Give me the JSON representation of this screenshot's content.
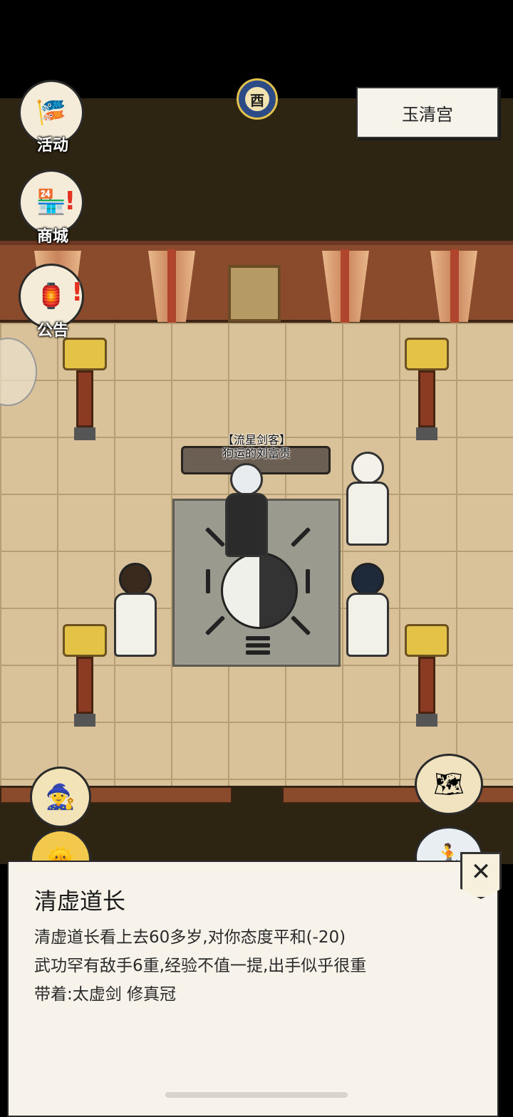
{
  "location": {
    "name": "玉清宫"
  },
  "clock": {
    "hour_glyph": "酉"
  },
  "side_menu": [
    {
      "key": "activity",
      "label": "活动",
      "icon": "banner-scroll-icon",
      "alert": ""
    },
    {
      "key": "shop",
      "label": "商城",
      "icon": "shop-stall-icon",
      "alert": "!"
    },
    {
      "key": "notice",
      "label": "公告",
      "icon": "notice-board-icon",
      "alert": "!"
    }
  ],
  "player": {
    "title": "【流星剑客】",
    "name": "狗运的刘富贵"
  },
  "dialog": {
    "npc_name": "清虚道长",
    "lines": [
      "清虚道长看上去60多岁,对你态度平和(-20)",
      "武功罕有敌手6重,经验不值一提,出手似乎很重",
      "带着:太虚剑 修真冠"
    ],
    "close_glyph": "✕"
  },
  "colors": {
    "wall": "#8a4a2c",
    "floor": "#d9c29a",
    "dark": "#2e2412",
    "panel": "#f7f3ea",
    "alert": "#e53322"
  }
}
